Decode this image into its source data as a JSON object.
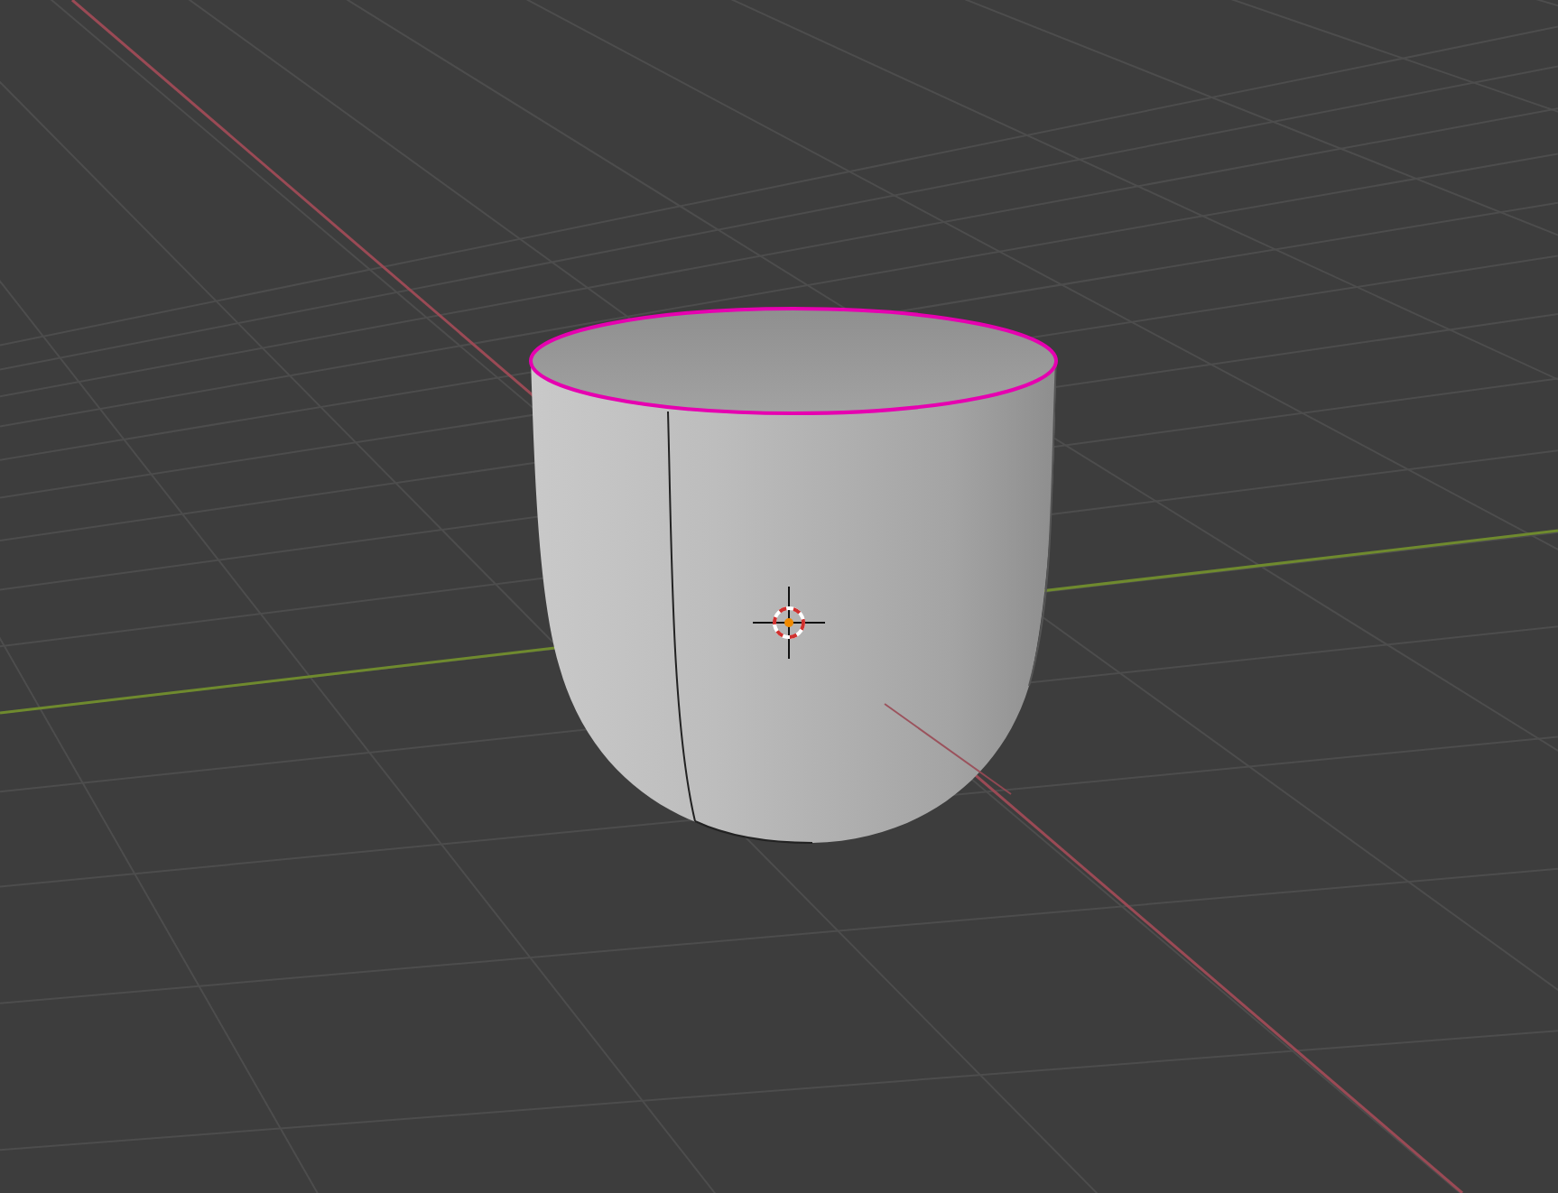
{
  "viewport": {
    "rim_edge_loop": {
      "selected": true
    }
  }
}
